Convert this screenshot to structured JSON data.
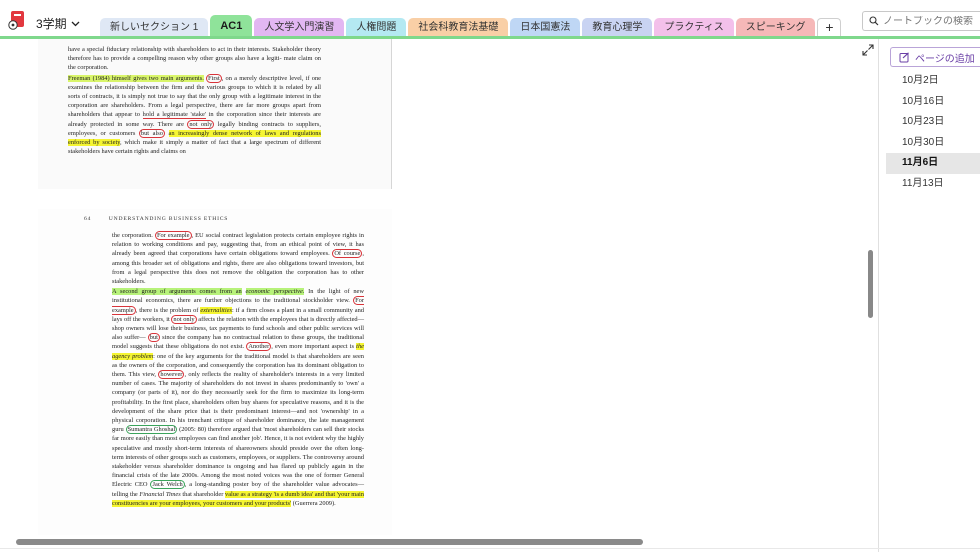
{
  "app": {
    "notebook_name": "3学期"
  },
  "colors": {
    "accent": "#7fd88c",
    "logo": "#e2383f",
    "add_page": "#6a3fa6"
  },
  "tabs": [
    {
      "label": "新しいセクション 1",
      "color": "#dfe8f5"
    },
    {
      "label": "AC1",
      "color": "#8fe39a",
      "active": true
    },
    {
      "label": "人文学入門演習",
      "color": "#e2b7f2"
    },
    {
      "label": "人権問題",
      "color": "#b4e9f2"
    },
    {
      "label": "社会科教育法基礎",
      "color": "#f9cfa6"
    },
    {
      "label": "日本国憲法",
      "color": "#bfd7f5"
    },
    {
      "label": "教育心理学",
      "color": "#c9d3f2"
    },
    {
      "label": "プラクティス",
      "color": "#f3c0ea"
    },
    {
      "label": "スピーキング",
      "color": "#f6b8b8"
    }
  ],
  "tab_add_label": "+",
  "search": {
    "placeholder": "ノートブックの検索"
  },
  "sidebar": {
    "add_page_label": "ページの追加",
    "pages": [
      {
        "label": "10月2日"
      },
      {
        "label": "10月16日"
      },
      {
        "label": "10月23日"
      },
      {
        "label": "10月30日"
      },
      {
        "label": "11月6日",
        "selected": true
      },
      {
        "label": "11月13日"
      }
    ]
  },
  "document": {
    "scan1": {
      "lines": [
        "have a special fiduciary relationship with shareholders to act in their interests. Stakeholder",
        "theory therefore has to provide a compelling reason why other groups also have a legiti-",
        "mate claim on the corporation."
      ],
      "para2_highlight": "Freeman (1984) himself gives two main arguments.",
      "para2_circled": "First",
      "para2_rest": ", on a merely descriptive level, if one examines the relationship between the firm and the various groups to which it is related by all sorts of contracts, it is simply not true to say that the only group with a legitimate interest in the corporation are shareholders. From a legal perspective, there are far more groups apart from shareholders that appear to",
      "para2_underlined": "hold a legitimate 'stake'",
      "para2_rest2": " in the corporation since their interests are already protected in some way. There are",
      "para2_circled2": "not only",
      "para2_rest3": " legally binding contracts to suppliers, employees, or customers",
      "para2_circled3": "but also",
      "para2_highlight2": "an increasingly dense network of laws and regulations enforced by society",
      "para2_rest4": ", which make it simply a matter of fact that a large spectrum of different stakeholders have certain rights and claims on"
    },
    "scan2": {
      "page_number": "64",
      "running_head": "UNDERSTANDING BUSINESS ETHICS",
      "p1_a": "the corporation.",
      "p1_circ1": "For example",
      "p1_b": ", EU social contract legislation protects certain employee rights in relation to working conditions and pay, suggesting that, from an ethical point of view, it has already been agreed that corporations have certain obligations toward employees.",
      "p1_circ2": "Of course",
      "p1_c": ", among this broader set of obligations and rights, there are also obligations toward investors, but from a legal perspective this does not remove the obligation the corporation has to other stakeholders.",
      "p2_hl": "A second group of arguments comes from an",
      "p2_hl_italic": "economic perspective.",
      "p2_a": " In the light of new institutional economics, there are further objections to the traditional stockholder view.",
      "p2_circ1": "For example",
      "p2_b": ", there is the problem of",
      "p2_hl2": "externalities",
      "p2_c": ": if a firm closes a plant in a small community and lays off the workers, it",
      "p2_circ2": "not only",
      "p2_d": " affects the relation with the employees that is directly affected—shop owners will lose their business, tax payments to fund schools and other public services will also suffer—",
      "p2_circ3": "but",
      "p2_e": " since the company has no contractual relation to these groups, the traditional model suggests that these obligations do not exist.",
      "p2_circ4": "Another",
      "p2_f": ", even more important aspect is",
      "p2_hl3": "the agency problem",
      "p2_g": ": one of the key arguments for the traditional model is that shareholders are seen as the owners of the corporation, and consequently the corporation has its dominant obligation to them. This view,",
      "p2_circ5": "however",
      "p2_h": ", only reflects the reality of shareholder's interests in a very limited number of cases. The majority of shareholders do not invest in shares predominantly to 'own' a company (or parts of it), nor do they necessarily seek for the firm to maximize its long-term profitability. In the first place, shareholders often buy shares for speculative reasons, and it is the development of the share price that is their predominant interest—and not 'ownership' in a physical corporation. In his trenchant critique of shareholder dominance, the late management guru",
      "p2_circ_g": "Sumantra Ghoshal",
      "p2_i": " (2005: 80) therefore argued that 'most shareholders can sell their stocks far more easily than most employees can find another job'. Hence, it is not evident why the highly speculative and mostly short-term interests of shareowners should preside over the often long-term interests of other groups such as customers, employees, or suppliers. The controversy around stakeholder versus shareholder dominance is ongoing and has flared up publicly again in the financial crisis of the late 2000s. Among the most noted voices was the one of former General Electric CEO",
      "p2_circ_g2": "Jack Welch",
      "p2_j": ", a long-standing poster boy of the shareholder value advocates—telling the",
      "p2_italic": "Financial Times",
      "p2_k": " that shareholder",
      "p2_hl4": "value as a strategy 'is a dumb idea' and that 'your main constituencies are your employees, your customers and your products'",
      "p2_l": " (Guerrera 2009)."
    }
  }
}
